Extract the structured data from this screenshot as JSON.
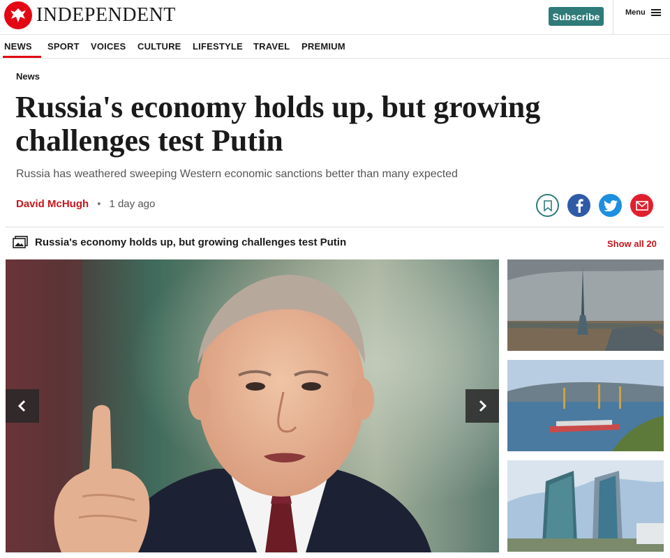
{
  "header": {
    "logo_text": "INDEPENDENT",
    "subscribe_label": "Subscribe",
    "menu_label": "Menu"
  },
  "nav": {
    "items": [
      "NEWS",
      "SPORT",
      "VOICES",
      "CULTURE",
      "LIFESTYLE",
      "TRAVEL",
      "PREMIUM"
    ],
    "active": "NEWS"
  },
  "article": {
    "section": "News",
    "headline": "Russia's economy holds up, but growing challenges test Putin",
    "standfirst": "Russia has weathered sweeping Western economic sanctions better than many expected",
    "author": "David McHugh",
    "separator": "•",
    "time": "1 day ago"
  },
  "share": {
    "icons": [
      "bookmark-icon",
      "facebook-icon",
      "twitter-icon",
      "email-icon"
    ]
  },
  "gallery": {
    "title": "Russia's economy holds up, but growing challenges test Putin",
    "show_all_label": "Show all 20",
    "thumbnails": [
      "tower-skyline-thumbnail",
      "port-cranes-thumbnail",
      "office-buildings-thumbnail"
    ]
  },
  "colors": {
    "brand_red": "#e30613",
    "subscribe_teal": "#2e7b79",
    "author_red": "#c4161c",
    "facebook_blue": "#2f5aa6",
    "twitter_blue": "#1d8fe0",
    "email_red": "#e0202e"
  }
}
